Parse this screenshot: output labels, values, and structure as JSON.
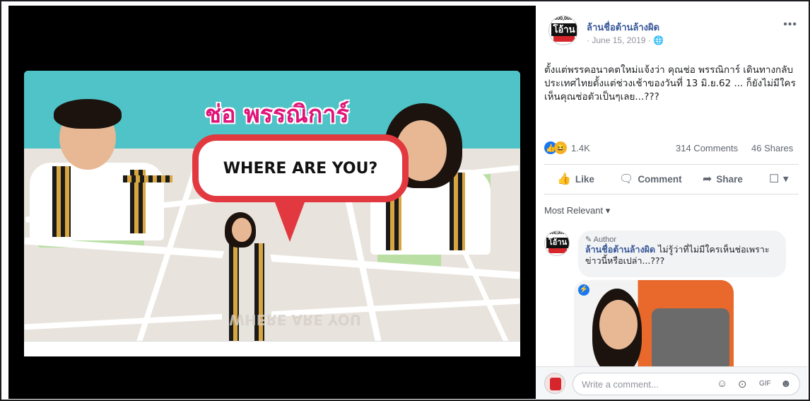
{
  "post": {
    "page_name": "ล้านชื่อต้านล้างผิด",
    "date": "June 15, 2019",
    "privacy_icon": "globe-icon",
    "more_label": "•••",
    "text": "ตั้งแต่พรรคอนาคตใหม่แจ้งว่า คุณช่อ พรรณิการ์ เดินทางกลับประเทศไทยตั้งแต่ช่วงเช้าของวันที่ 13 มิ.ย.62 ... ก็ยังไม่มีใครเห็นคุณช่อตัวเป็นๆเลย...???"
  },
  "avatar": {
    "top": "000,000",
    "mid": "โอ้าน"
  },
  "image": {
    "headline": "ช่อ พรรณิการ์",
    "bubble_text": "WHERE ARE YOU?",
    "mirror_text": "WHERE ARE YOU"
  },
  "reactions": {
    "count": "1.4K",
    "comments": "314 Comments",
    "shares": "46 Shares",
    "like_color": "#1877f2",
    "haha_color": "#f7b125"
  },
  "actions": {
    "like": "Like",
    "comment": "Comment",
    "share": "Share"
  },
  "sort": {
    "label": "Most Relevant ▾"
  },
  "comment": {
    "badge": "Author",
    "name": "ล้านชื่อต้านล้างผิด",
    "text": "ไม่รู้ว่าที่ไม่มีใครเห็นช่อเพราะข่าวนี้หรือเปล่า...???"
  },
  "composer": {
    "placeholder": "Write a comment..."
  }
}
